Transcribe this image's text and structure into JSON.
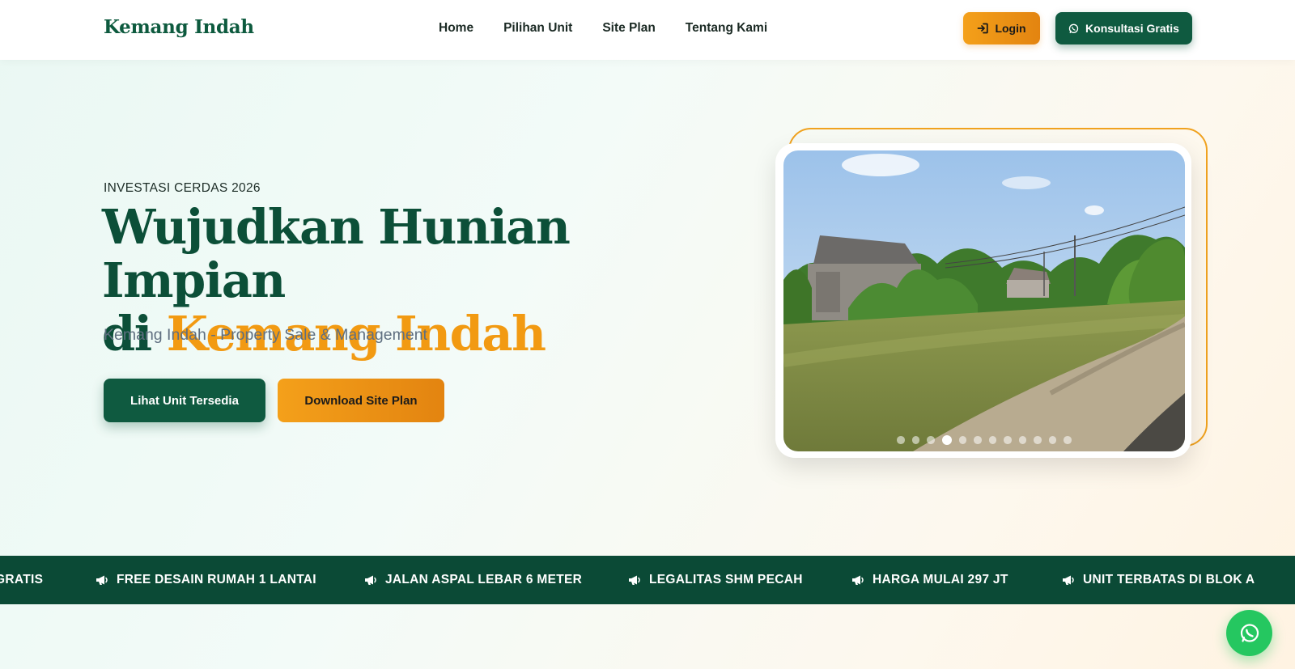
{
  "navbar": {
    "brand": "Kemang Indah",
    "links": [
      "Home",
      "Pilihan Unit",
      "Site Plan",
      "Tentang Kami"
    ],
    "login_label": "Login",
    "consult_label": "Konsultasi Gratis"
  },
  "hero": {
    "eyebrow": "INVESTASI CERDAS 2026",
    "title_line1": "Wujudkan Hunian Impian",
    "title_prefix": "di ",
    "title_accent": "Kemang Indah",
    "subtitle": "Kemang Indah - Property Sale & Management",
    "primary_button": "Lihat Unit Tersedia",
    "secondary_button": "Download Site Plan",
    "slider": {
      "total_slides": 12,
      "active_index": 3
    }
  },
  "marquee": {
    "items": [
      "GRATIS",
      "FREE DESAIN RUMAH 1 LANTAI",
      "JALAN ASPAL LEBAR 6 METER",
      "LEGALITAS SHM PECAH",
      "HARGA MULAI 297 JT",
      "UNIT TERBATAS DI BLOK A"
    ]
  },
  "icons": {
    "login": "sign-in-icon",
    "consult": "whatsapp-icon",
    "marquee": "megaphone-icon",
    "floating": "whatsapp-icon"
  },
  "colors": {
    "primary_green": "#0f5a40",
    "accent_orange": "#f29a12",
    "banner_green": "#0b4a36",
    "whatsapp_green": "#25c760"
  }
}
